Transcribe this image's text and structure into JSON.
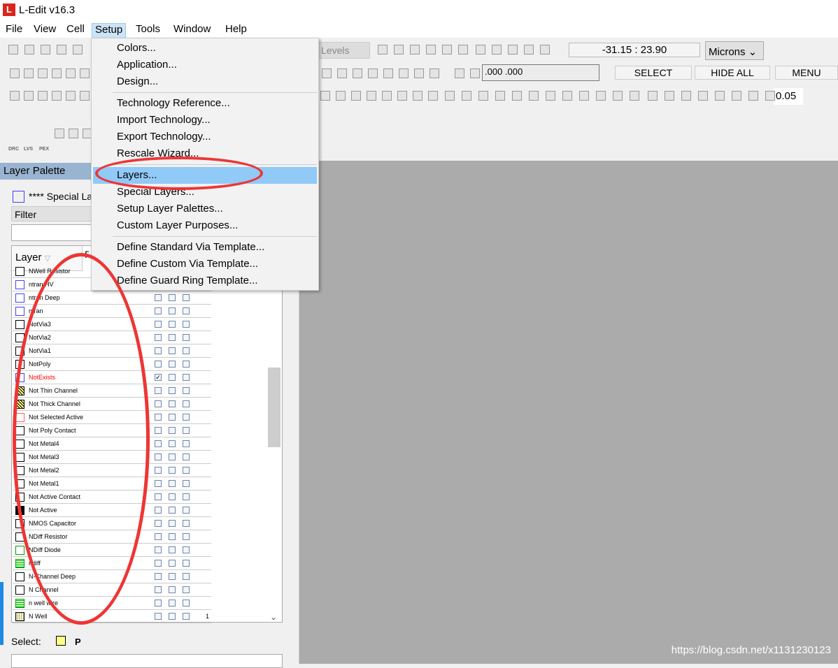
{
  "app": {
    "title": "L-Edit v16.3",
    "logo": "L"
  },
  "menubar": [
    "File",
    "View",
    "Cell",
    "Setup",
    "Tools",
    "Window",
    "Help"
  ],
  "toolbar": {
    "levels": "Levels",
    "coords": "-31.15 : 23.90",
    "units": "Microns",
    "snap": ".000 .000",
    "select": "SELECT",
    "hide_all": "HIDE ALL",
    "menu": "MENU",
    "grid_value": "0.05",
    "verify_labels": [
      "DRC",
      "LVS",
      "PEX"
    ]
  },
  "setup_menu": {
    "groups": [
      [
        "Colors...",
        "Application...",
        "Design..."
      ],
      [
        "Technology Reference...",
        "Import Technology...",
        "Export Technology...",
        "Rescale Wizard..."
      ],
      [
        "Layers...",
        "Special Layers...",
        "Setup Layer Palettes...",
        "Custom Layer Purposes..."
      ],
      [
        "Define Standard Via Template...",
        "Define Custom Via Template...",
        "Define Guard Ring Template..."
      ]
    ],
    "highlighted": "Layers..."
  },
  "palette": {
    "title": "Layer Palette",
    "special": "**** Special Layers",
    "filter_label": "Filter",
    "filter_value": "",
    "col_layer": "Layer",
    "col_p": "P",
    "select_label": "Select:",
    "layers": [
      {
        "name": "NWell Resistor",
        "color": "#000000"
      },
      {
        "name": "ntran HV",
        "color": "#4040ff"
      },
      {
        "name": "ntran Deep",
        "color": "#4040ff"
      },
      {
        "name": "ntran",
        "color": "#4040ff"
      },
      {
        "name": "NotVia3",
        "color": "#000000"
      },
      {
        "name": "NotVia2",
        "color": "#000000"
      },
      {
        "name": "NotVia1",
        "color": "#000000"
      },
      {
        "name": "NotPoly",
        "color": "#000000"
      },
      {
        "name": "NotExists",
        "color": "#4040ff",
        "text": "#ff0000",
        "checked": true
      },
      {
        "name": "Not Thin Channel",
        "color": "#000000",
        "fill": "hatch"
      },
      {
        "name": "Not Thick Channel",
        "color": "#000000",
        "fill": "hatch"
      },
      {
        "name": "Not Selected Active",
        "color": "#ff6060"
      },
      {
        "name": "Not Poly Contact",
        "color": "#000000"
      },
      {
        "name": "Not Metal4",
        "color": "#000000"
      },
      {
        "name": "Not Metal3",
        "color": "#000000"
      },
      {
        "name": "Not Metal2",
        "color": "#000000"
      },
      {
        "name": "Not Metal1",
        "color": "#000000"
      },
      {
        "name": "Not Active Contact",
        "color": "#000000"
      },
      {
        "name": "Not Active",
        "color": "#000000",
        "fill": "solid"
      },
      {
        "name": "NMOS Capacitor",
        "color": "#000000"
      },
      {
        "name": "NDiff Resistor",
        "color": "#000000"
      },
      {
        "name": "NDiff Diode",
        "color": "#00a000"
      },
      {
        "name": "ndiff",
        "color": "#00a000",
        "fill": "green"
      },
      {
        "name": "N-Channel Deep",
        "color": "#000000"
      },
      {
        "name": "N Channel",
        "color": "#000000"
      },
      {
        "name": "n well wire",
        "color": "#00a000",
        "fill": "green"
      },
      {
        "name": "N Well",
        "color": "#000000",
        "fill": "dots",
        "extra": "1"
      }
    ]
  },
  "watermark": "https://blog.csdn.net/x1131230123"
}
